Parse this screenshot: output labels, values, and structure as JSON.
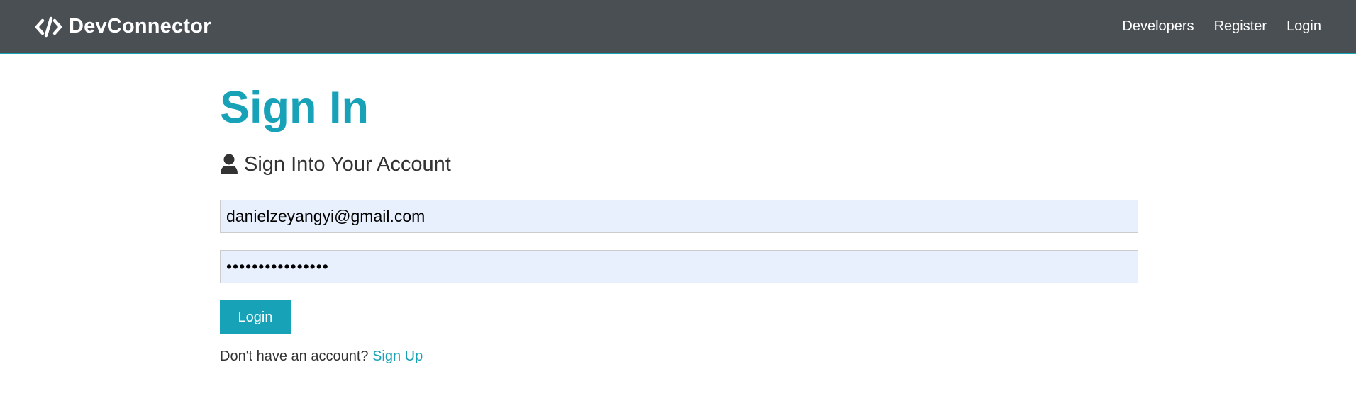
{
  "navbar": {
    "brand_icon": "code-icon",
    "brand_text": "DevConnector",
    "links": [
      {
        "label": "Developers"
      },
      {
        "label": "Register"
      },
      {
        "label": "Login"
      }
    ]
  },
  "main": {
    "title": "Sign In",
    "lead_icon": "user-icon",
    "lead_text": "Sign Into Your Account",
    "email": {
      "value": "danielzeyangyi@gmail.com"
    },
    "password": {
      "value": "••••••••••••••••"
    },
    "login_button": "Login",
    "signup_prompt": "Don't have an account?",
    "signup_link": "Sign Up"
  },
  "colors": {
    "navbar_bg": "#4a4f54",
    "accent": "#17a2b8",
    "input_bg": "#e8f0fe"
  }
}
